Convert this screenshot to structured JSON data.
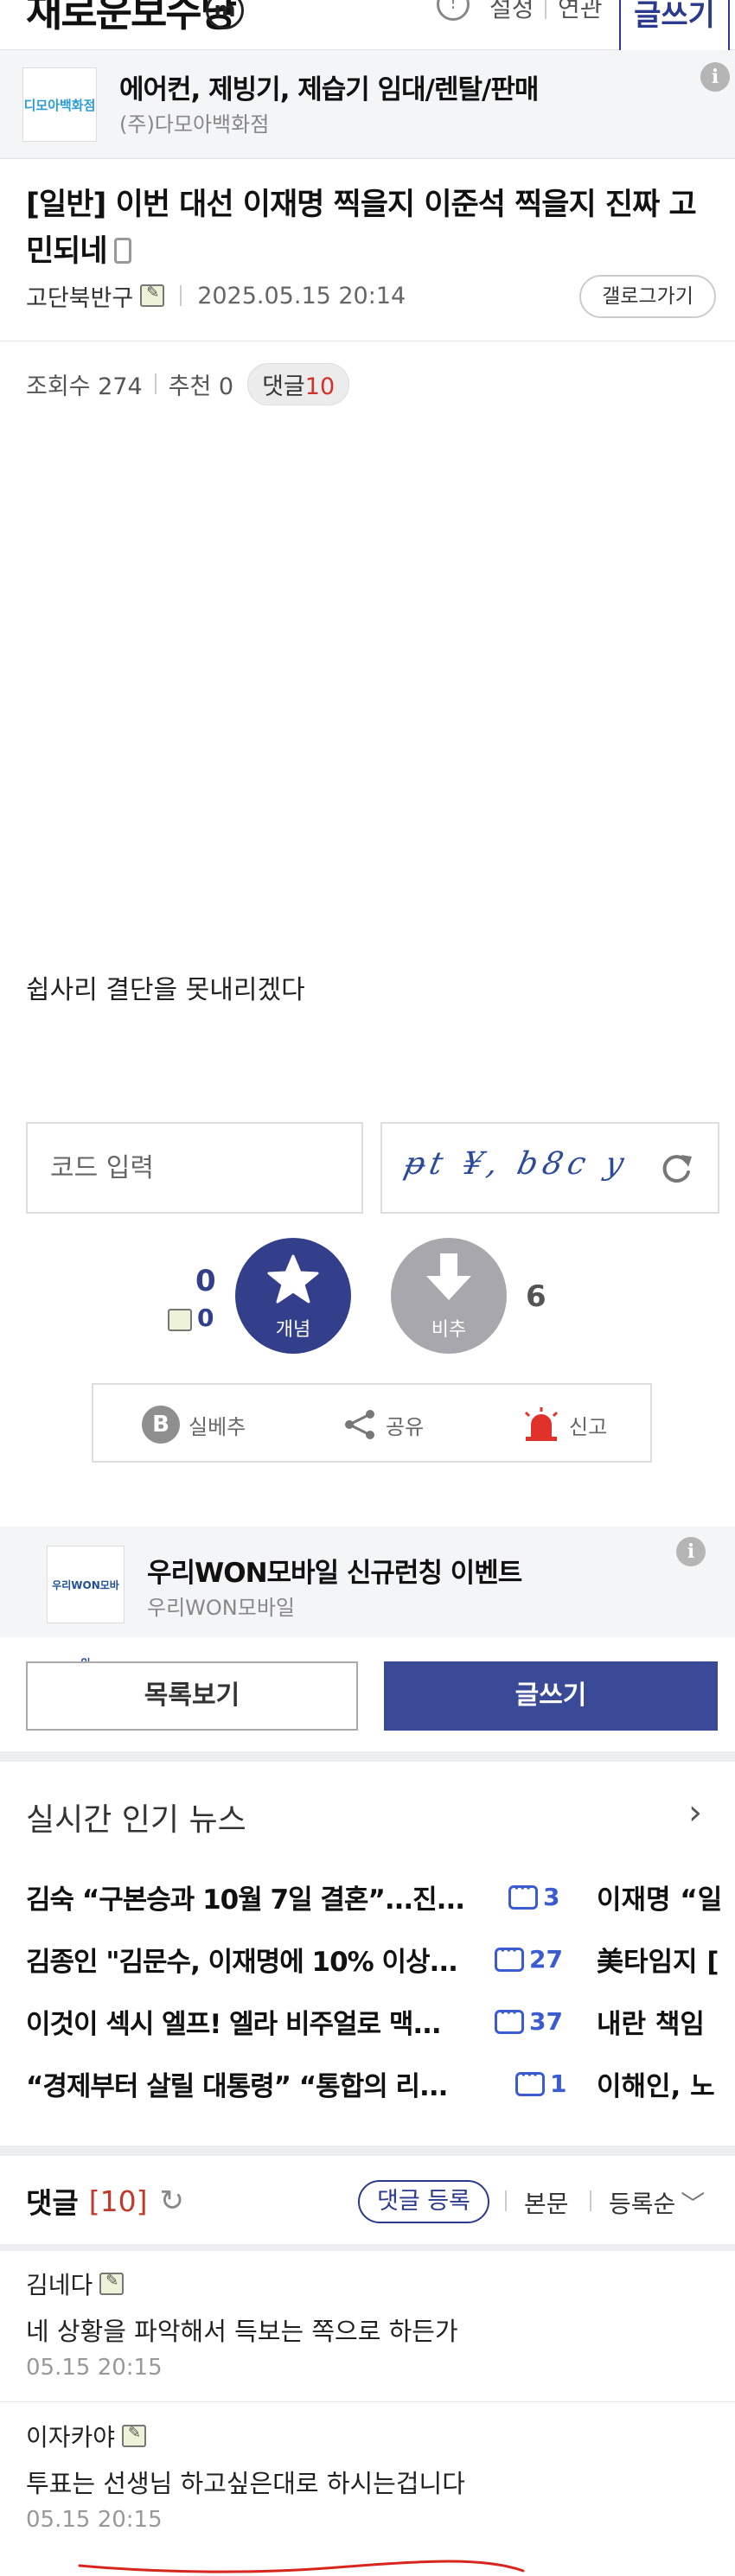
{
  "header": {
    "gallery_name": "재로운보수당",
    "badge": "m",
    "setting_label": "설정",
    "related_label": "연관",
    "write_label": "글쓰기"
  },
  "ad_top": {
    "title": "에어컨, 제빙기, 제습기 임대/렌탈/판매",
    "advertiser": "(주)다모아백화점",
    "logo_text": "디모아백화점",
    "info": "i"
  },
  "post": {
    "title": "[일반] 이번 대선 이재명 찍을지 이준석 찍을지 진짜 고민되네",
    "author": "고단북반구",
    "date": "2025.05.15 20:14",
    "gallery_button": "갤로그가기",
    "views_label": "조회수 274",
    "recommend_label": "추천 0",
    "reply_label": "댓글",
    "reply_count": "10",
    "body": "쉽사리 결단을 못내리겠다"
  },
  "captcha": {
    "placeholder": "코드 입력",
    "code_text": "ᵽt ¥, b8c y"
  },
  "votes": {
    "up_count": "0",
    "up_fix_count": "0",
    "up_label": "개념",
    "down_label": "비추",
    "down_count": "6"
  },
  "actions": {
    "silbe": "실베추",
    "silbe_icon": "B",
    "share": "공유",
    "report": "신고"
  },
  "ad_mid": {
    "title": "우리WON모바일 신규런칭 이벤트",
    "advertiser": "우리WON모바일",
    "logo_text": "우리WON모바일",
    "info": "i"
  },
  "buttons": {
    "list": "목록보기",
    "write": "글쓰기"
  },
  "news": {
    "title": "실시간 인기 뉴스",
    "arrow": "›",
    "items": [
      {
        "text": "김숙 “구본승과 10월 7일 결혼”...진...",
        "count": "3",
        "side": "이재명 “일"
      },
      {
        "text": "김종인 \"김문수, 이재명에 10% 이상...",
        "count": "27",
        "side": "美타임지 ["
      },
      {
        "text": "이것이 섹시 엘프! 엘라 비주얼로 맥...",
        "count": "37",
        "side": "내란 책임"
      },
      {
        "text": "“경제부터 살릴 대통령” “통합의 리...",
        "count": "1",
        "side": "이해인, 노"
      }
    ]
  },
  "comments": {
    "title": "댓글",
    "count": "[10]",
    "register": "댓글 등록",
    "tab_body": "본문",
    "tab_sort": "등록순",
    "items": [
      {
        "author": "김네다",
        "text": "네 상황을 파악해서 득보는 쪽으로 하든가",
        "date": "05.15 20:15"
      },
      {
        "author": "이자카야",
        "text": "투표는 선생님 하고싶은대로 하시는겁니다",
        "date": "05.15 20:15"
      }
    ]
  }
}
